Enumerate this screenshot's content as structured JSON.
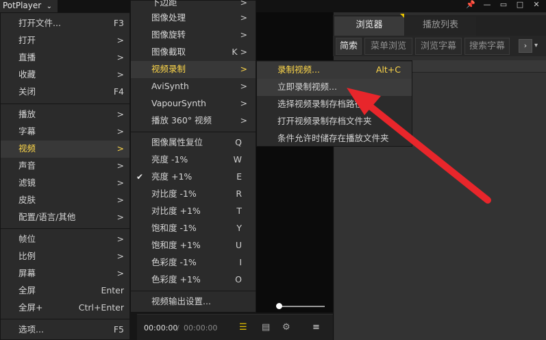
{
  "app": {
    "title": "PotPlayer"
  },
  "colors": {
    "accent": "#ffd84a",
    "arrow": "#e8262b",
    "menu_bg": "#2b2b2b"
  },
  "menu1": {
    "items": [
      {
        "label": "打开文件...",
        "key": "F3"
      },
      {
        "label": "打开",
        "key": ">"
      },
      {
        "label": "直播",
        "key": ">"
      },
      {
        "label": "收藏",
        "key": ">"
      },
      {
        "label": "关闭",
        "key": "F4"
      },
      {
        "label": "播放",
        "key": ">"
      },
      {
        "label": "字幕",
        "key": ">"
      },
      {
        "label": "视频",
        "key": ">"
      },
      {
        "label": "声音",
        "key": ">"
      },
      {
        "label": "滤镜",
        "key": ">"
      },
      {
        "label": "皮肤",
        "key": ">"
      },
      {
        "label": "配置/语言/其他",
        "key": ">"
      },
      {
        "label": "帧位",
        "key": ">"
      },
      {
        "label": "比例",
        "key": ">"
      },
      {
        "label": "屏幕",
        "key": ">"
      },
      {
        "label": "全屏",
        "key": "Enter"
      },
      {
        "label": "全屏+",
        "key": "Ctrl+Enter"
      },
      {
        "label": "选项...",
        "key": "F5"
      }
    ]
  },
  "menu2": {
    "items": [
      {
        "label": "下边距",
        "key": ">"
      },
      {
        "label": "图像处理",
        "key": ">"
      },
      {
        "label": "图像旋转",
        "key": ">"
      },
      {
        "label": "图像截取",
        "key": "K >"
      },
      {
        "label": "视频录制",
        "key": ">"
      },
      {
        "label": "AviSynth",
        "key": ">"
      },
      {
        "label": "VapourSynth",
        "key": ">"
      },
      {
        "label": "播放 360° 视频",
        "key": ">"
      },
      {
        "label": "图像属性复位",
        "key": "Q"
      },
      {
        "label": "亮度 -1%",
        "key": "W"
      },
      {
        "label": "亮度 +1%",
        "key": "E"
      },
      {
        "label": "对比度 -1%",
        "key": "R"
      },
      {
        "label": "对比度 +1%",
        "key": "T"
      },
      {
        "label": "饱和度 -1%",
        "key": "Y"
      },
      {
        "label": "饱和度 +1%",
        "key": "U"
      },
      {
        "label": "色彩度 -1%",
        "key": "I"
      },
      {
        "label": "色彩度 +1%",
        "key": "O"
      },
      {
        "label": "视频输出设置...",
        "key": ""
      }
    ]
  },
  "menu3": {
    "items": [
      {
        "label": "录制视频...",
        "key": "Alt+C"
      },
      {
        "label": "立即录制视频...",
        "key": ""
      },
      {
        "label": "选择视频录制存档路径",
        "key": ""
      },
      {
        "label": "打开视频录制存档文件夹",
        "key": ""
      },
      {
        "label": "条件允许时储存在播放文件夹",
        "key": ""
      }
    ]
  },
  "panel": {
    "tabs": [
      "浏览器",
      "播放列表"
    ],
    "subtabs": [
      "简索",
      "菜单浏览",
      "浏览字幕",
      "搜索字幕"
    ]
  },
  "player": {
    "time_current": "00:00:00",
    "time_sep": "/",
    "time_total": "00:00:00",
    "volume_level": 0.0
  }
}
